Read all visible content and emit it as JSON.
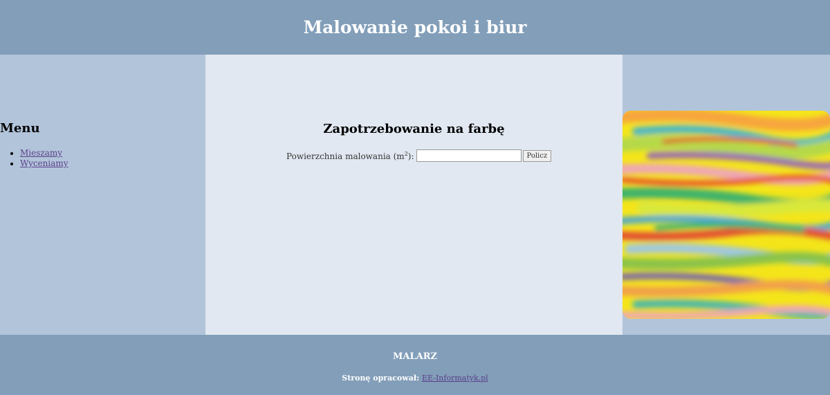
{
  "header": {
    "title": "Malowanie pokoi i biur"
  },
  "sidebar": {
    "title": "Menu",
    "items": [
      {
        "label": "Mieszamy"
      },
      {
        "label": "Wyceniamy"
      }
    ]
  },
  "main": {
    "heading": "Zapotrzebowanie na farbę",
    "form": {
      "label_prefix": "Powierzchnia malowania (m",
      "label_sup": "2",
      "label_suffix": "):",
      "input_value": "",
      "button_label": "Policz"
    }
  },
  "image": {
    "description_icon": "colorful-paint-strokes-image"
  },
  "footer": {
    "brand": "MALARZ",
    "credit_text": "Stronę opracował:",
    "credit_link": "EE-Informatyk.pl"
  },
  "colors": {
    "header_bg": "#829eb9",
    "sidebar_bg": "#b2c4da",
    "main_bg": "#e1e8f1",
    "link": "#5a3f8a"
  }
}
